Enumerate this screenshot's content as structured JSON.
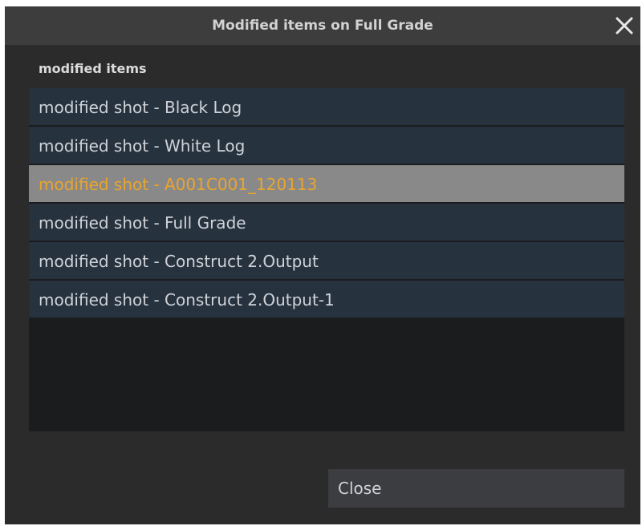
{
  "dialog": {
    "title": "Modified items on Full Grade",
    "close_icon": "close-icon"
  },
  "list": {
    "header": "modified items",
    "items": [
      {
        "label": "modified shot - Black Log",
        "selected": false
      },
      {
        "label": "modified shot - White Log",
        "selected": false
      },
      {
        "label": "modified shot - A001C001_120113",
        "selected": true
      },
      {
        "label": "modified shot - Full Grade",
        "selected": false
      },
      {
        "label": "modified shot - Construct 2.Output",
        "selected": false
      },
      {
        "label": "modified shot - Construct 2.Output-1",
        "selected": false
      }
    ]
  },
  "footer": {
    "close_label": "Close"
  },
  "colors": {
    "selected_text": "#e8a530",
    "selected_bg": "#8a8989",
    "row_bg": "#27323f"
  }
}
